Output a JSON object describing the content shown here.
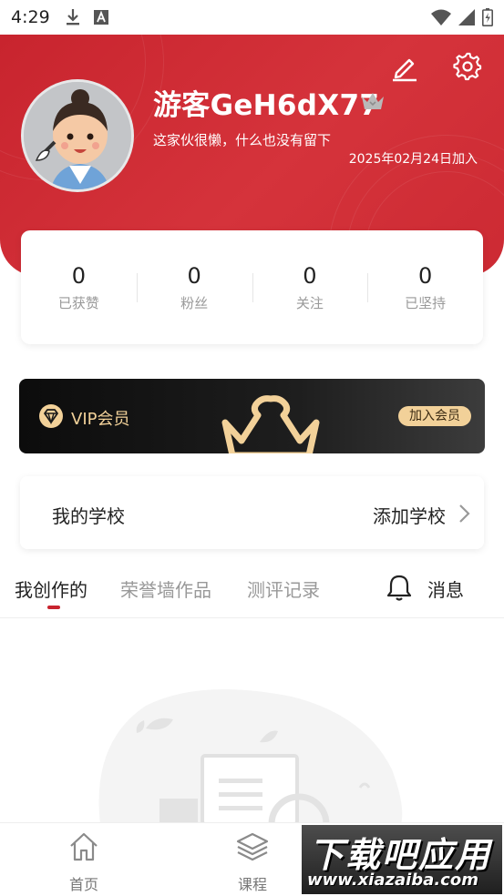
{
  "status_bar": {
    "time": "4:29",
    "icons": [
      "download-icon",
      "a-badge-icon",
      "wifi-icon",
      "signal-icon",
      "battery-icon"
    ]
  },
  "profile": {
    "username": "游客GeH6dX77",
    "bio": "这家伙很懒，什么也没有留下",
    "join_date": "2025年02月24日加入",
    "icons": [
      "edit-icon",
      "settings-icon",
      "crown-icon"
    ],
    "header_color": "#c8242e"
  },
  "stats": [
    {
      "value": "0",
      "label": "已获赞"
    },
    {
      "value": "0",
      "label": "粉丝"
    },
    {
      "value": "0",
      "label": "关注"
    },
    {
      "value": "0",
      "label": "已坚持"
    }
  ],
  "vip": {
    "label": "VIP会员",
    "button": "加入会员",
    "accent_color": "#f2d199"
  },
  "school": {
    "label": "我的学校",
    "action": "添加学校"
  },
  "tabs": [
    {
      "label": "我创作的",
      "active": true
    },
    {
      "label": "荣誉墙作品",
      "active": false
    },
    {
      "label": "测评记录",
      "active": false
    }
  ],
  "messages": {
    "label": "消息"
  },
  "bottom_nav": [
    {
      "label": "首页",
      "icon": "home-icon"
    },
    {
      "label": "课程",
      "icon": "layers-icon"
    }
  ],
  "watermark": {
    "title": "下载吧应用",
    "url": "www.xiazaiba.com"
  }
}
